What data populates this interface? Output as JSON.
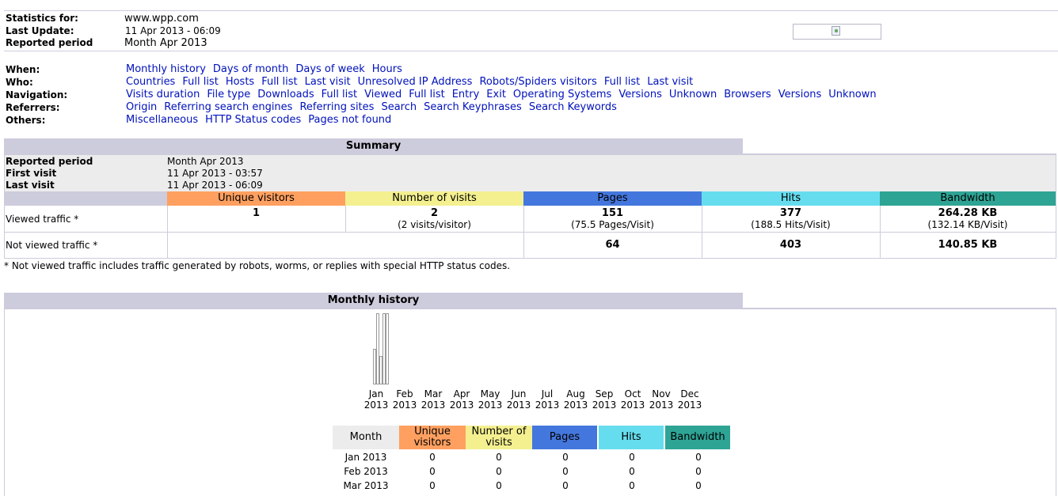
{
  "header": {
    "statistics_for_label": "Statistics for:",
    "statistics_for_value": "www.wpp.com",
    "last_update_label": "Last Update:",
    "last_update_value": "11 Apr 2013 - 06:09",
    "reported_period_label": "Reported period",
    "reported_period_value": "Month Apr 2013"
  },
  "menu": {
    "when": {
      "label": "When:",
      "links": [
        "Monthly history",
        "Days of month",
        "Days of week",
        "Hours"
      ]
    },
    "who": {
      "label": "Who:",
      "links": [
        "Countries",
        "Full list",
        "Hosts",
        "Full list",
        "Last visit",
        "Unresolved IP Address",
        "Robots/Spiders visitors",
        "Full list",
        "Last visit"
      ]
    },
    "navigation": {
      "label": "Navigation:",
      "links": [
        "Visits duration",
        "File type",
        "Downloads",
        "Full list",
        "Viewed",
        "Full list",
        "Entry",
        "Exit",
        "Operating Systems",
        "Versions",
        "Unknown",
        "Browsers",
        "Versions",
        "Unknown"
      ]
    },
    "referrers": {
      "label": "Referrers:",
      "links": [
        "Origin",
        "Referring search engines",
        "Referring sites",
        "Search",
        "Search Keyphrases",
        "Search Keywords"
      ]
    },
    "others": {
      "label": "Others:",
      "links": [
        "Miscellaneous",
        "HTTP Status codes",
        "Pages not found"
      ]
    }
  },
  "summary": {
    "title": "Summary",
    "reported_period_label": "Reported period",
    "reported_period_value": "Month Apr 2013",
    "first_visit_label": "First visit",
    "first_visit_value": "11 Apr 2013 - 03:57",
    "last_visit_label": "Last visit",
    "last_visit_value": "11 Apr 2013 - 06:09",
    "columns": [
      "Unique visitors",
      "Number of visits",
      "Pages",
      "Hits",
      "Bandwidth"
    ],
    "viewed_label": "Viewed traffic *",
    "viewed": {
      "unique_visitors": "1",
      "visits": "2",
      "visits_sub": "(2 visits/visitor)",
      "pages": "151",
      "pages_sub": "(75.5 Pages/Visit)",
      "hits": "377",
      "hits_sub": "(188.5 Hits/Visit)",
      "bandwidth": "264.28 KB",
      "bandwidth_sub": "(132.14 KB/Visit)"
    },
    "not_viewed_label": "Not viewed traffic *",
    "not_viewed": {
      "pages": "64",
      "hits": "403",
      "bandwidth": "140.85 KB"
    },
    "footnote": "* Not viewed traffic includes traffic generated by robots, worms, or replies with special HTTP status codes."
  },
  "monthly": {
    "title": "Monthly history",
    "table_headers": [
      "Month",
      "Unique visitors",
      "Number of visits",
      "Pages",
      "Hits",
      "Bandwidth"
    ],
    "rows": [
      {
        "month": "Jan 2013",
        "unique": "0",
        "visits": "0",
        "pages": "0",
        "hits": "0",
        "bandwidth": "0"
      },
      {
        "month": "Feb 2013",
        "unique": "0",
        "visits": "0",
        "pages": "0",
        "hits": "0",
        "bandwidth": "0"
      },
      {
        "month": "Mar 2013",
        "unique": "0",
        "visits": "0",
        "pages": "0",
        "hits": "0",
        "bandwidth": "0"
      }
    ]
  },
  "colors": {
    "unique_visitors": "#ffa060",
    "visits": "#f4f090",
    "pages": "#4477dd",
    "hits": "#66ddee",
    "bandwidth": "#2ea495",
    "section_bg": "#ccccdd",
    "link": "#0011bb"
  },
  "chart_data": {
    "type": "bar",
    "categories": [
      "Jan 2013",
      "Feb 2013",
      "Mar 2013",
      "Apr 2013",
      "May 2013",
      "Jun 2013",
      "Jul 2013",
      "Aug 2013",
      "Sep 2013",
      "Oct 2013",
      "Nov 2013",
      "Dec 2013"
    ],
    "category_labels": [
      [
        "Jan",
        "2013"
      ],
      [
        "Feb",
        "2013"
      ],
      [
        "Mar",
        "2013"
      ],
      [
        "Apr",
        "2013"
      ],
      [
        "May",
        "2013"
      ],
      [
        "Jun",
        "2013"
      ],
      [
        "Jul",
        "2013"
      ],
      [
        "Aug",
        "2013"
      ],
      [
        "Sep",
        "2013"
      ],
      [
        "Oct",
        "2013"
      ],
      [
        "Nov",
        "2013"
      ],
      [
        "Dec",
        "2013"
      ]
    ],
    "series": [
      {
        "key": "unique_visitors",
        "values": [
          0,
          0,
          0,
          1,
          0,
          0,
          0,
          0,
          0,
          0,
          0,
          0
        ]
      },
      {
        "key": "visits",
        "values": [
          0,
          0,
          0,
          2,
          0,
          0,
          0,
          0,
          0,
          0,
          0,
          0
        ]
      },
      {
        "key": "pages",
        "values": [
          0,
          0,
          0,
          151,
          0,
          0,
          0,
          0,
          0,
          0,
          0,
          0
        ]
      },
      {
        "key": "hits",
        "values": [
          0,
          0,
          0,
          377,
          0,
          0,
          0,
          0,
          0,
          0,
          0,
          0
        ]
      },
      {
        "key": "bandwidth",
        "values": [
          0,
          0,
          0,
          264.28,
          0,
          0,
          0,
          0,
          0,
          0,
          0,
          0
        ]
      }
    ]
  }
}
